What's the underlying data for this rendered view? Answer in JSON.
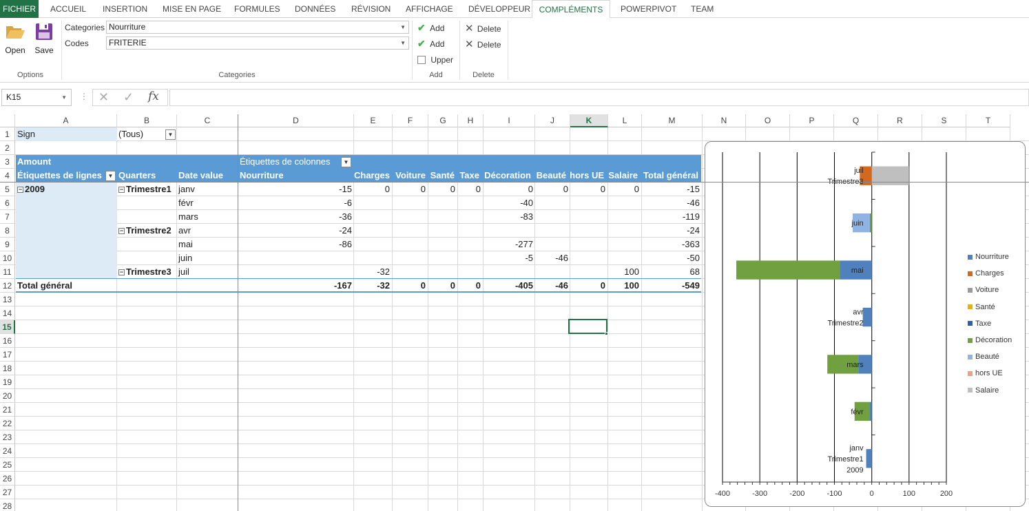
{
  "tabs": [
    "FICHIER",
    "ACCUEIL",
    "INSERTION",
    "MISE EN PAGE",
    "FORMULES",
    "DONNÉES",
    "RÉVISION",
    "AFFICHAGE",
    "DÉVELOPPEUR",
    "COMPLÉMENTS",
    "POWERPIVOT",
    "TEAM"
  ],
  "active_tab": "COMPLÉMENTS",
  "ribbon": {
    "open_label": "Open",
    "save_label": "Save",
    "options_group": "Options",
    "categories_label": "Categories",
    "categories_value": "Nourriture",
    "codes_label": "Codes",
    "codes_value": "FRITERIE",
    "categories_group": "Categories",
    "add1": "Add",
    "add2": "Add",
    "upper": "Upper",
    "add_group": "Add",
    "delete1": "Delete",
    "delete2": "Delete",
    "delete_group": "Delete"
  },
  "namebox": "K15",
  "formula": "",
  "columns": [
    "A",
    "B",
    "C",
    "D",
    "E",
    "F",
    "G",
    "H",
    "I",
    "J",
    "K",
    "L",
    "M",
    "N",
    "O",
    "P",
    "Q",
    "R",
    "S",
    "T"
  ],
  "selected_col": "K",
  "selected_row": "15",
  "rows": [
    "1",
    "2",
    "3",
    "4",
    "5",
    "6",
    "7",
    "8",
    "9",
    "10",
    "11",
    "12",
    "13",
    "14",
    "15",
    "16",
    "17",
    "18",
    "19",
    "20",
    "21",
    "22",
    "23",
    "24",
    "25",
    "26",
    "27",
    "28"
  ],
  "pivot": {
    "filter_label": "Sign",
    "filter_value": "(Tous)",
    "amount": "Amount",
    "col_labels": "Étiquettes de colonnes",
    "row_labels": "Étiquettes de lignes",
    "quarters": "Quarters",
    "date_value": "Date value",
    "headers": [
      "Nourriture",
      "Charges",
      "Voiture",
      "Santé",
      "Taxe",
      "Décoration",
      "Beauté",
      "hors UE",
      "Salaire",
      "Total général"
    ],
    "year": "2009",
    "q1": "Trimestre1",
    "q2": "Trimestre2",
    "q3": "Trimestre3",
    "data_rows": [
      {
        "month": "janv",
        "vals": [
          "-15",
          "0",
          "0",
          "0",
          "0",
          "0",
          "0",
          "0",
          "0",
          "-15"
        ]
      },
      {
        "month": "févr",
        "vals": [
          "-6",
          "",
          "",
          "",
          "",
          "-40",
          "",
          "",
          "",
          "-46"
        ]
      },
      {
        "month": "mars",
        "vals": [
          "-36",
          "",
          "",
          "",
          "",
          "-83",
          "",
          "",
          "",
          "-119"
        ]
      },
      {
        "month": "avr",
        "vals": [
          "-24",
          "",
          "",
          "",
          "",
          "",
          "",
          "",
          "",
          "-24"
        ]
      },
      {
        "month": "mai",
        "vals": [
          "-86",
          "",
          "",
          "",
          "",
          "-277",
          "",
          "",
          "",
          "-363"
        ]
      },
      {
        "month": "juin",
        "vals": [
          "",
          "",
          "",
          "",
          "",
          "-5",
          "-46",
          "",
          "",
          "-50"
        ]
      },
      {
        "month": "juil",
        "vals": [
          "",
          "-32",
          "",
          "",
          "",
          "",
          "",
          "",
          "100",
          "68"
        ]
      }
    ],
    "total_label": "Total général",
    "totals": [
      "-167",
      "-32",
      "0",
      "0",
      "0",
      "-405",
      "-46",
      "0",
      "100",
      "-549"
    ]
  },
  "chart_data": {
    "type": "bar",
    "orientation": "horizontal",
    "stacked": true,
    "categories": [
      "janv",
      "févr",
      "mars",
      "avr",
      "mai",
      "juin",
      "juil"
    ],
    "category_labels": [
      [
        "janv",
        "Trimestre1",
        "2009"
      ],
      [
        "févr"
      ],
      [
        "mars"
      ],
      [
        "avr",
        "Trimestre2"
      ],
      [
        "mai"
      ],
      [
        "juin"
      ],
      [
        "juil",
        "Trimestre3"
      ]
    ],
    "series": [
      {
        "name": "Nourriture",
        "color": "#4f81bd",
        "values": [
          -15,
          -6,
          -36,
          -24,
          -86,
          0,
          0
        ]
      },
      {
        "name": "Charges",
        "color": "#d2691e",
        "values": [
          0,
          0,
          0,
          0,
          0,
          0,
          -32
        ]
      },
      {
        "name": "Voiture",
        "color": "#9b9b9b",
        "values": [
          0,
          0,
          0,
          0,
          0,
          0,
          0
        ]
      },
      {
        "name": "Santé",
        "color": "#e8b000",
        "values": [
          0,
          0,
          0,
          0,
          0,
          0,
          0
        ]
      },
      {
        "name": "Taxe",
        "color": "#2e5fa8",
        "values": [
          0,
          0,
          0,
          0,
          0,
          0,
          0
        ]
      },
      {
        "name": "Décoration",
        "color": "#70a040",
        "values": [
          0,
          -40,
          -83,
          0,
          -277,
          -5,
          0
        ]
      },
      {
        "name": "Beauté",
        "color": "#8fb4e3",
        "values": [
          0,
          0,
          0,
          0,
          0,
          -46,
          0
        ]
      },
      {
        "name": "hors UE",
        "color": "#f0a080",
        "values": [
          0,
          0,
          0,
          0,
          0,
          0,
          0
        ]
      },
      {
        "name": "Salaire",
        "color": "#bfbfbf",
        "values": [
          0,
          0,
          0,
          0,
          0,
          0,
          100
        ]
      }
    ],
    "xticks": [
      "-400",
      "-300",
      "-200",
      "-100",
      "0",
      "100",
      "200"
    ],
    "xlim": [
      -400,
      200
    ],
    "grid": true,
    "legend": "right"
  }
}
